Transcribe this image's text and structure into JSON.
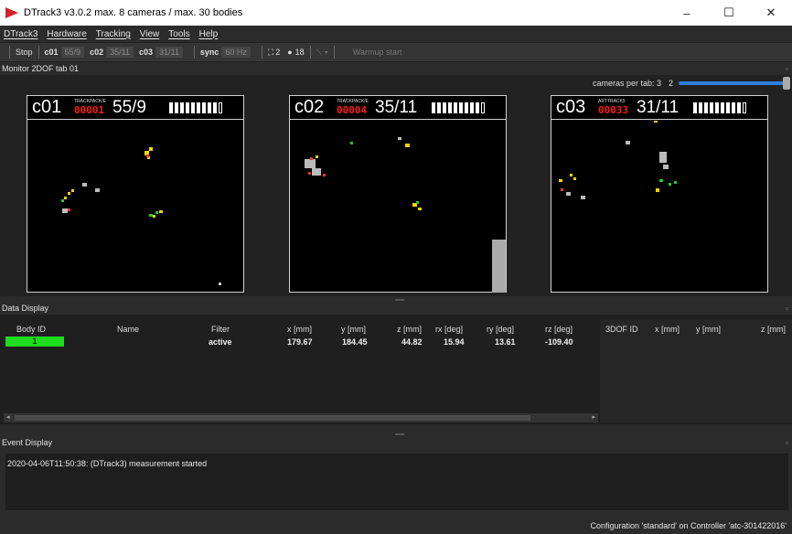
{
  "window": {
    "title": "DTrack3 v3.0.2 max. 8 cameras / max. 30 bodies",
    "controls": [
      "–",
      "☐",
      "✕"
    ]
  },
  "menu": [
    "DTrack3",
    "Hardware",
    "Tracking",
    "View",
    "Tools",
    "Help"
  ],
  "toolbar": {
    "stop": "Stop",
    "cams": [
      {
        "label": "c01",
        "value": "55/9"
      },
      {
        "label": "c02",
        "value": "35/11"
      },
      {
        "label": "c03",
        "value": "31/11"
      }
    ],
    "sync_label": "sync",
    "sync_value": "60 Hz",
    "count_a": "2",
    "count_b": "18",
    "warmup": "Warmup start"
  },
  "monitor": {
    "title": "Monitor 2DOF tab 01",
    "cameras_per_tab_label": "cameras per tab: 3",
    "cameras_per_tab_value": "2",
    "cams": [
      {
        "name": "c01",
        "track_label": "TRACKPACK/E",
        "track_value": "00001",
        "count": "55/9",
        "bars_full": 9
      },
      {
        "name": "c02",
        "track_label": "TRACKPACK/E",
        "track_value": "00004",
        "count": "35/11",
        "bars_full": 9
      },
      {
        "name": "c03",
        "track_label": "ARTTRACK5",
        "track_value": "00033",
        "count": "31/11",
        "bars_full": 9
      }
    ]
  },
  "data_display": {
    "title": "Data Display",
    "columns": [
      "Body ID",
      "Name",
      "Filter",
      "x [mm]",
      "y [mm]",
      "z [mm]",
      "rx [deg]",
      "ry [deg]",
      "rz [deg]"
    ],
    "columns_right": [
      "3DOF ID",
      "x [mm]",
      "y [mm]",
      "z [mm]"
    ],
    "row": {
      "body_id": "1",
      "name": "",
      "filter": "active",
      "x": "179.67",
      "y": "184.45",
      "z": "44.82",
      "rx": "15.94",
      "ry": "13.61",
      "rz": "-109.40"
    }
  },
  "event_display": {
    "title": "Event Display",
    "line": "2020-04-06T11:50:38: (DTrack3) measurement started"
  },
  "status": "Configuration 'standard' on Controller 'atc-301422016'"
}
